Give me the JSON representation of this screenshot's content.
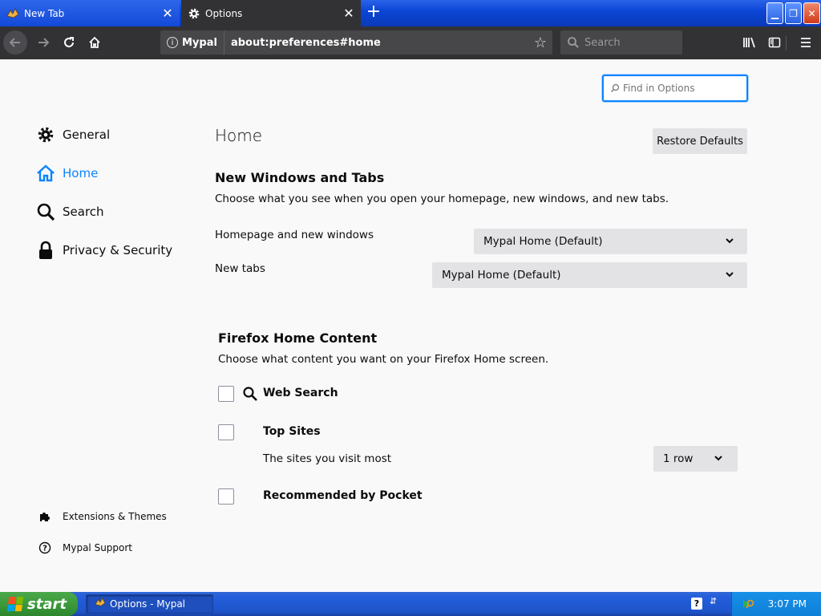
{
  "tabs": [
    {
      "label": "New Tab",
      "icon": "mypal-icon",
      "selected": false
    },
    {
      "label": "Options",
      "icon": "gear-icon",
      "selected": true
    }
  ],
  "window_buttons": {
    "minimize": "minimize-icon",
    "restore": "restore-icon",
    "close": "close-icon"
  },
  "navbar": {
    "identity_label": "Mypal",
    "url": "about:preferences#home",
    "search_placeholder": "Search"
  },
  "find": {
    "placeholder": "Find in Options"
  },
  "sidebar": {
    "items": [
      {
        "label": "General",
        "icon": "gear-icon",
        "selected": false
      },
      {
        "label": "Home",
        "icon": "home-icon",
        "selected": true
      },
      {
        "label": "Search",
        "icon": "search-icon",
        "selected": false
      },
      {
        "label": "Privacy & Security",
        "icon": "lock-icon",
        "selected": false
      }
    ],
    "footer": [
      {
        "label": "Extensions & Themes",
        "icon": "puzzle-icon"
      },
      {
        "label": "Mypal Support",
        "icon": "help-icon"
      }
    ]
  },
  "home": {
    "title": "Home",
    "restore_button": "Restore Defaults",
    "new_windows": {
      "heading": "New Windows and Tabs",
      "description": "Choose what you see when you open your homepage, new windows, and new tabs.",
      "homepage_label": "Homepage and new windows",
      "homepage_value": "Mypal Home (Default)",
      "newtabs_label": "New tabs",
      "newtabs_value": "Mypal Home (Default)"
    },
    "content": {
      "heading": "Firefox Home Content",
      "description": "Choose what content you want on your Firefox Home screen.",
      "web_search": {
        "label": "Web Search",
        "checked": false
      },
      "top_sites": {
        "label": "Top Sites",
        "checked": false,
        "sub_label": "The sites you visit most",
        "rows_value": "1 row"
      },
      "pocket": {
        "label": "Recommended by Pocket",
        "checked": false
      }
    }
  },
  "taskbar": {
    "start_label": "start",
    "task_label": "Options - Mypal",
    "clock": "3:07 PM"
  },
  "colors": {
    "accent": "#0a84ff",
    "toolbar": "#323234",
    "content_bg": "#f9f9fa",
    "taskbar": "#245edb",
    "start": "#3c9a3c"
  }
}
